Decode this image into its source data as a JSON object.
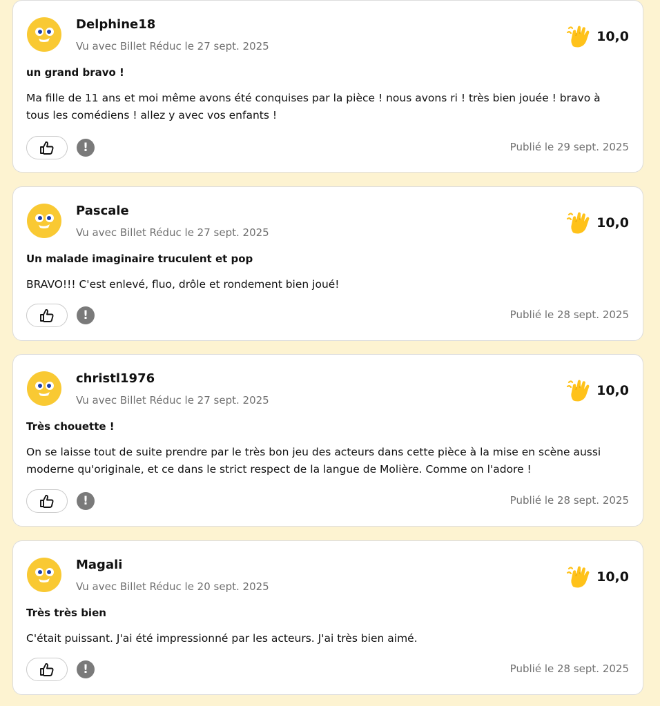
{
  "reviews": [
    {
      "username": "Delphine18",
      "seen_with": "Vu avec Billet Réduc le 27 sept. 2025",
      "score": "10,0",
      "title": "un grand bravo !",
      "body": "Ma fille de 11 ans et moi même avons été conquises par la pièce ! nous avons ri ! très bien jouée ! bravo à tous les comédiens ! allez y avec vos enfants !",
      "published": "Publié le 29 sept. 2025"
    },
    {
      "username": "Pascale",
      "seen_with": "Vu avec Billet Réduc le 27 sept. 2025",
      "score": "10,0",
      "title": "Un malade imaginaire truculent et pop",
      "body": "BRAVO!!! C'est enlevé, fluo, drôle et rondement bien joué!",
      "published": "Publié le 28 sept. 2025"
    },
    {
      "username": "christl1976",
      "seen_with": "Vu avec Billet Réduc le 27 sept. 2025",
      "score": "10,0",
      "title": "Très chouette !",
      "body": "On se laisse tout de suite prendre par le très bon jeu des acteurs dans cette pièce à la mise en scène aussi moderne qu'originale, et ce dans le strict respect de la langue de Molière. Comme on l'adore !",
      "published": "Publié le 28 sept. 2025"
    },
    {
      "username": "Magali",
      "seen_with": "Vu avec Billet Réduc le 20 sept. 2025",
      "score": "10,0",
      "title": "Très très bien",
      "body": "C'était puissant. J'ai été impressionné par les acteurs. J'ai très bien aimé.",
      "published": "Publié le 28 sept. 2025"
    }
  ],
  "icons": {
    "avatar": "smiley-face-icon",
    "rating": "clapping-hand-icon",
    "like": "thumbs-up-icon",
    "report": "exclamation-icon"
  },
  "report_glyph": "!",
  "colors": {
    "page_background": "#fdf3d1",
    "avatar_yellow": "#f9c933",
    "hand_yellow": "#ffc21a",
    "muted_text": "#707070",
    "report_grey": "#7a7a7a"
  }
}
